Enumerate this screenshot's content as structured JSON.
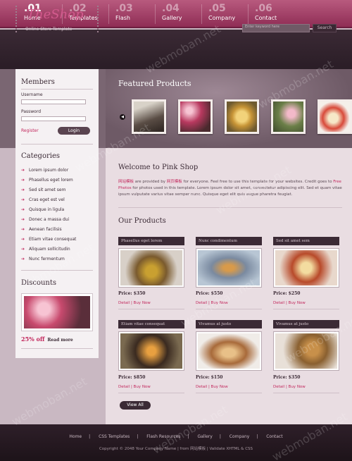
{
  "nav": [
    {
      "num": ".01",
      "label": "Home"
    },
    {
      "num": ".02",
      "label": "Templates"
    },
    {
      "num": ".03",
      "label": "Flash"
    },
    {
      "num": ".04",
      "label": "Gallery"
    },
    {
      "num": ".05",
      "label": "Company"
    },
    {
      "num": ".06",
      "label": "Contact"
    }
  ],
  "header": {
    "logo": "TheShop",
    "subtitle": "Online Store Template",
    "search_placeholder": "Enter keyword here",
    "search_button": "Search"
  },
  "featured": {
    "title": "Featured Products"
  },
  "sidebar": {
    "members_title": "Members",
    "username_label": "Username",
    "password_label": "Password",
    "register": "Register",
    "login": "Login",
    "categories_title": "Categories",
    "categories": [
      "Lorem ipsum dolor",
      "Phasellus eget lorem",
      "Sed sit amet sem",
      "Cras eget est vel",
      "Quisque in ligula",
      "Donec a massa dui",
      "Aenean facilisis",
      "Etiam vitae consequat",
      "Aliquam sollicitudin",
      "Nunc fermentum"
    ],
    "discounts_title": "Discounts",
    "discount_value": "25% off",
    "read_more": "Read more"
  },
  "welcome": {
    "title": "Welcome to Pink Shop",
    "hl1": "网站模板",
    "t1": " are provided by ",
    "hl2": "网页模板",
    "t2": " for everyone. Feel free to use this template for your websites. Credit goes to ",
    "hl3": "Free Photos",
    "t3": " for photos used in this template. Lorem ipsum dolor sit amet, consectetur adipiscing elit. Sed et quam vitae ipsum vulputate varius vitae semper nunc. Quisque eget elit quis augue pharetra feugiat."
  },
  "products_title": "Our Products",
  "products": [
    {
      "name": "Phasellus eget lorem",
      "price": "Price: $350",
      "links": "Detail | Buy Now"
    },
    {
      "name": "Nunc condimentum",
      "price": "Price: $550",
      "links": "Detail | Buy Now"
    },
    {
      "name": "Sed sit amet sem",
      "price": "Price: $250",
      "links": "Detail | Buy Now"
    },
    {
      "name": "Etiam vitae consequat",
      "price": "Price: $850",
      "links": "Detail | Buy Now"
    },
    {
      "name": "Vivamus at justo",
      "price": "Price: $150",
      "links": "Detail | Buy Now"
    },
    {
      "name": "Vivamus at justo",
      "price": "Price: $350",
      "links": "Detail | Buy Now"
    }
  ],
  "view_all": "View All",
  "footer": {
    "links": [
      "Home",
      "CSS Templates",
      "Flash Resources",
      "Gallery",
      "Company",
      "Contact"
    ],
    "copyright": "Copyright © 2048 Your Company Name | from 网站模板 | Validate XHTML & CSS"
  },
  "watermark": "webmoban.net",
  "colors": {
    "accent": "#c2275c",
    "dark": "#3b2a35",
    "nav": "#8f2d55"
  }
}
